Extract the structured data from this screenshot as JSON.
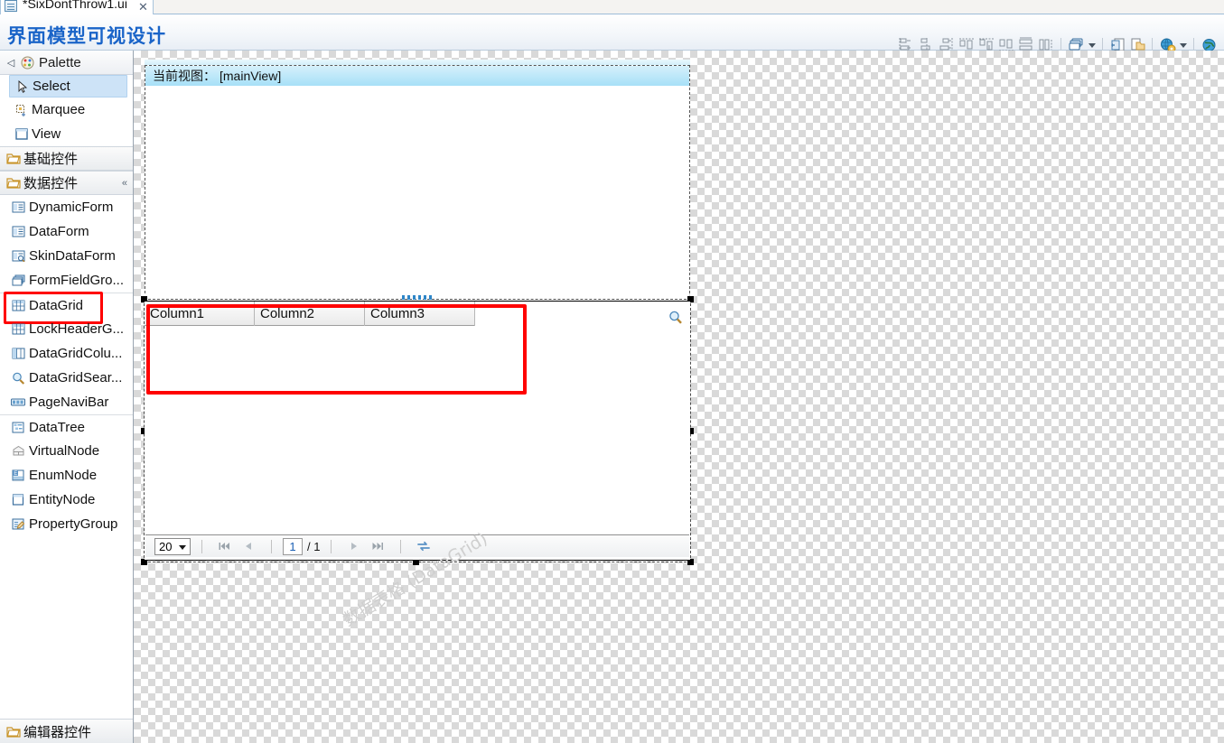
{
  "tab": {
    "label": "*SixDontThrow1.ui",
    "close": "✕",
    "icon": "editor-file-icon"
  },
  "header": {
    "title": "界面模型可视设计"
  },
  "toolbar": {
    "groups": [
      {
        "name": "align-distribute",
        "buttons": [
          {
            "name": "align-left-icon",
            "label": "Align Left"
          },
          {
            "name": "align-center-icon",
            "label": "Align Center"
          },
          {
            "name": "align-right-icon",
            "label": "Align Right"
          },
          {
            "name": "align-top-icon",
            "label": "Align Top"
          },
          {
            "name": "align-middle-icon",
            "label": "Align Middle"
          },
          {
            "name": "align-bottom-icon",
            "label": "Align Bottom"
          },
          {
            "name": "distribute-vertical-icon",
            "label": "Distribute Vertically"
          },
          {
            "name": "distribute-horizontal-icon",
            "label": "Distribute Horizontally"
          }
        ]
      },
      {
        "name": "layer-order",
        "buttons": [
          {
            "name": "bring-to-front-icon",
            "label": "Layer Order"
          }
        ],
        "dropdown": true
      },
      {
        "name": "clipboard",
        "buttons": [
          {
            "name": "copy-icon",
            "label": "Copy"
          },
          {
            "name": "paste-icon",
            "label": "Paste"
          }
        ]
      },
      {
        "name": "preview",
        "buttons": [
          {
            "name": "globe-settings-icon",
            "label": "Preview Settings"
          }
        ],
        "dropdown": true
      },
      {
        "name": "browser-preview",
        "buttons": [
          {
            "name": "globe-icon",
            "label": "Preview in Browser"
          }
        ]
      }
    ]
  },
  "palette": {
    "header": {
      "label": "Palette",
      "icon": "palette-icon",
      "collapse_icon": "◁"
    },
    "tools": [
      {
        "label": "Select",
        "icon": "cursor-arrow-icon",
        "selected": true
      },
      {
        "label": "Marquee",
        "icon": "marquee-select-icon",
        "selected": false
      },
      {
        "label": "View",
        "icon": "view-rect-icon",
        "selected": false
      }
    ],
    "sections": [
      {
        "label": "基础控件",
        "icon": "folder-icon",
        "collapsed": true,
        "chevron": "",
        "items": []
      },
      {
        "label": "数据控件",
        "icon": "folder-icon",
        "collapsed": false,
        "chevron": "«",
        "items": [
          {
            "label": "DynamicForm",
            "icon": "form-icon",
            "group_start": false,
            "highlight": false
          },
          {
            "label": "DataForm",
            "icon": "form-icon",
            "group_start": false,
            "highlight": false
          },
          {
            "label": "SkinDataForm",
            "icon": "skin-form-icon",
            "group_start": false,
            "highlight": false
          },
          {
            "label": "FormFieldGro...",
            "icon": "form-group-icon",
            "group_start": false,
            "highlight": false
          },
          {
            "label": "DataGrid",
            "icon": "grid-icon",
            "group_start": true,
            "highlight": true
          },
          {
            "label": "LockHeaderG...",
            "icon": "grid-icon",
            "group_start": false,
            "highlight": false
          },
          {
            "label": "DataGridColu...",
            "icon": "grid-column-icon",
            "group_start": false,
            "highlight": false
          },
          {
            "label": "DataGridSear...",
            "icon": "magnifier-icon",
            "group_start": false,
            "highlight": false
          },
          {
            "label": "PageNaviBar",
            "icon": "page-navi-icon",
            "group_start": false,
            "highlight": false
          },
          {
            "label": "DataTree",
            "icon": "tree-icon",
            "group_start": true,
            "highlight": false
          },
          {
            "label": "VirtualNode",
            "icon": "virtual-node-icon",
            "group_start": false,
            "highlight": false
          },
          {
            "label": "EnumNode",
            "icon": "enum-node-icon",
            "group_start": false,
            "highlight": false
          },
          {
            "label": "EntityNode",
            "icon": "entity-node-icon",
            "group_start": false,
            "highlight": false
          },
          {
            "label": "PropertyGroup",
            "icon": "property-group-icon",
            "group_start": false,
            "highlight": false
          }
        ]
      }
    ],
    "footer": {
      "label": "编辑器控件",
      "icon": "folder-icon"
    }
  },
  "canvas": {
    "view_panel": {
      "header_label": "当前视图：",
      "header_value": "[mainView]"
    },
    "datagrid": {
      "columns": [
        "Column1",
        "Column2",
        "Column3"
      ],
      "watermark": "数据表格 (DataGrid)",
      "magnifier_icon": "magnifier-icon",
      "selected": true,
      "pager": {
        "page_size": "20",
        "first_icon": "first-page-icon",
        "prev_icon": "prev-page-icon",
        "current_page": "1",
        "total_pages": "/ 1",
        "next_icon": "next-page-icon",
        "last_icon": "last-page-icon",
        "refresh_icon": "refresh-icon"
      }
    }
  },
  "colors": {
    "title": "#1a64c8",
    "highlight_box": "#ff0000",
    "view_header": "#a7e0f7",
    "selection": "#cde3f7"
  }
}
